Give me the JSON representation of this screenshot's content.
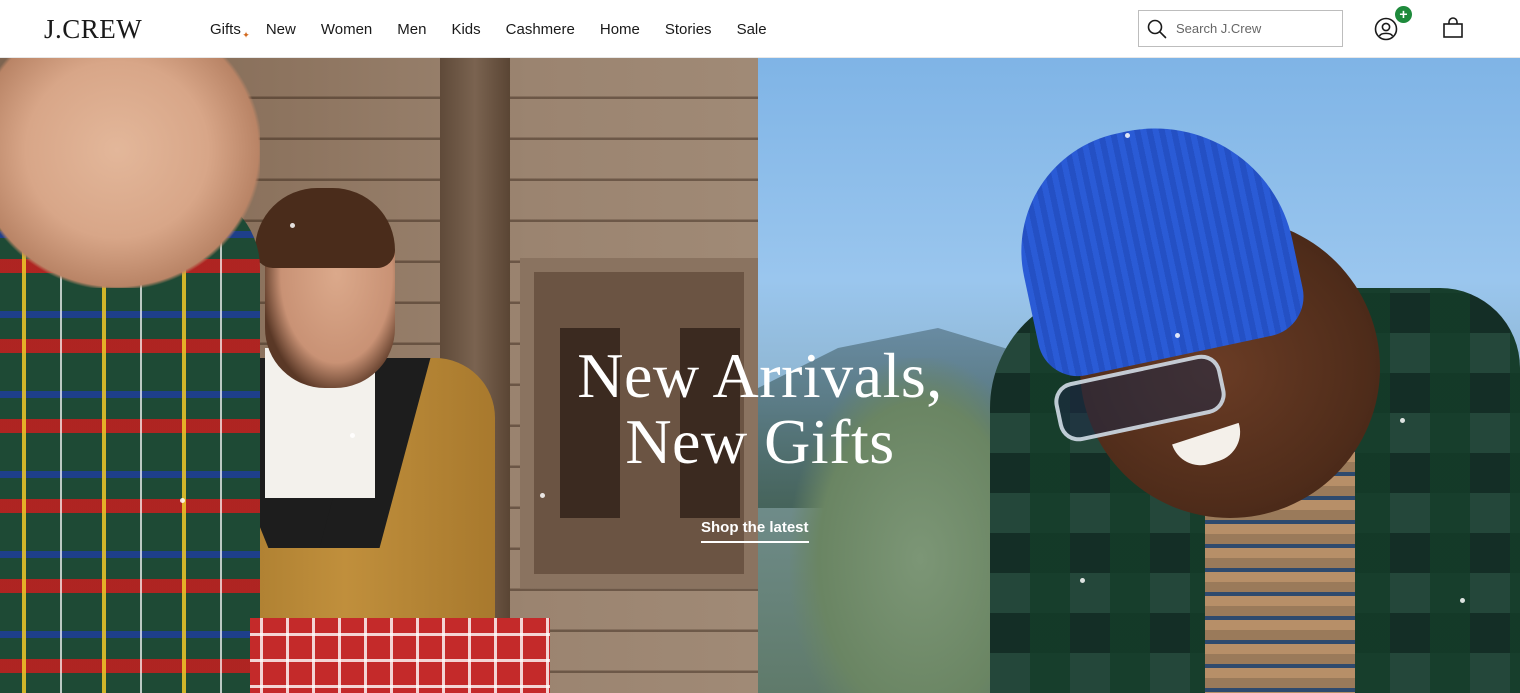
{
  "header": {
    "logo": "J.CREW",
    "nav": [
      "Gifts",
      "New",
      "Women",
      "Men",
      "Kids",
      "Cashmere",
      "Home",
      "Stories",
      "Sale"
    ],
    "search_placeholder": "Search J.Crew",
    "account_badge": "+",
    "icons": {
      "search": "search-icon",
      "account": "account-icon",
      "bag": "shopping-bag-icon"
    },
    "colors": {
      "badge": "#1e8a3c",
      "sparkle": "#d2691e"
    }
  },
  "hero": {
    "title_line1": "New Arrivals,",
    "title_line2": "New Gifts",
    "cta": "Shop the latest"
  }
}
